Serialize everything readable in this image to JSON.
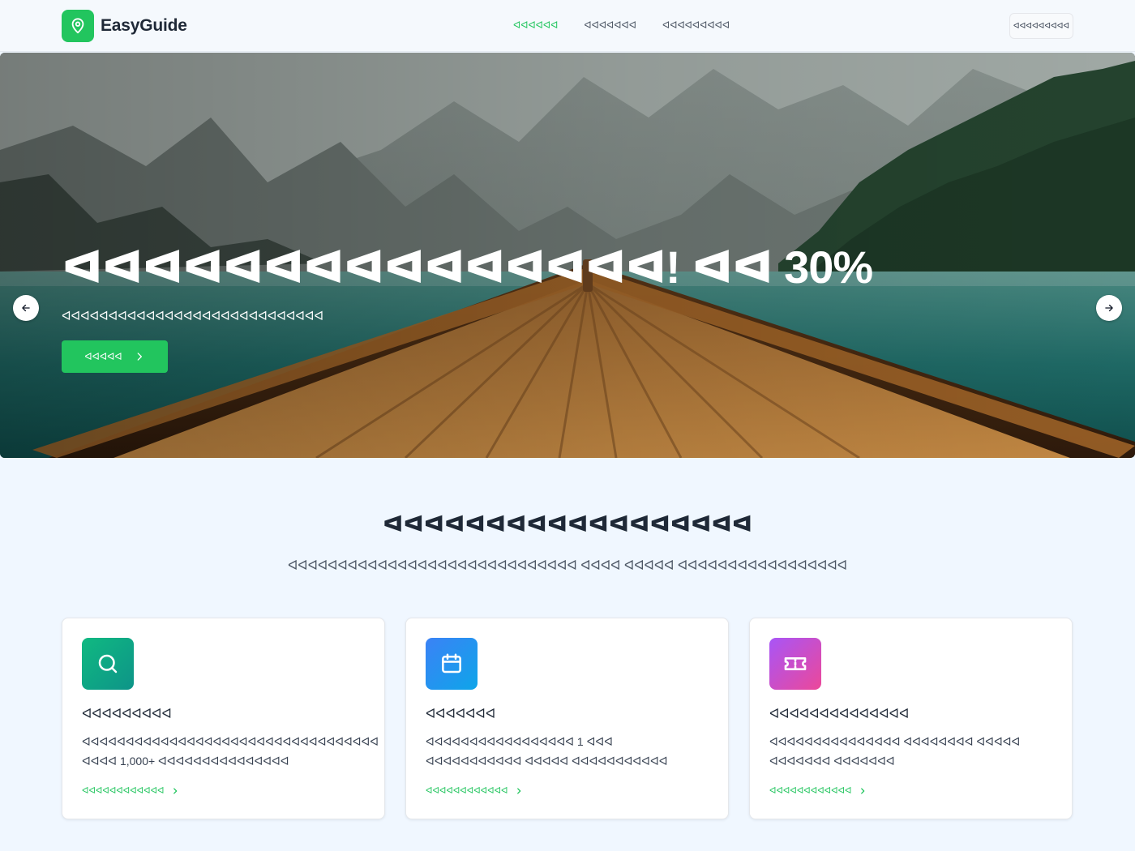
{
  "brand": {
    "name": "EasyGuide",
    "icon": "map-pin-icon",
    "accent": "#22c55e"
  },
  "nav": {
    "items": [
      {
        "label": "ᐊᐊᐊᐊᐊᐊ",
        "active": true
      },
      {
        "label": "ᐊᐊᐊᐊᐊᐊᐊ",
        "active": false
      },
      {
        "label": "ᐊᐊᐊᐊᐊᐊᐊᐊᐊ",
        "active": false
      }
    ],
    "signin": "ᐊᐊᐊᐊᐊᐊᐊᐊᐊ"
  },
  "hero": {
    "title": "ᐊᐊᐊᐊᐊᐊᐊᐊᐊᐊᐊᐊᐊᐊᐊ! ᐊᐊ 30%",
    "subtitle": "ᐊᐊᐊᐊᐊᐊᐊᐊᐊᐊᐊᐊᐊᐊᐊᐊᐊᐊᐊᐊᐊᐊᐊᐊᐊᐊᐊᐊ",
    "cta": "ᐊᐊᐊᐊᐊ",
    "prev_icon": "arrow-left-icon",
    "next_icon": "arrow-right-icon"
  },
  "features": {
    "title": "ᐊᐊᐊᐊᐊᐊᐊᐊᐊᐊᐊᐊᐊᐊᐊᐊᐊᐊ",
    "subtitle": "ᐊᐊᐊᐊᐊᐊᐊᐊᐊᐊᐊᐊᐊᐊᐊᐊᐊᐊᐊᐊᐊᐊᐊᐊᐊᐊᐊᐊᐊ ᐊᐊᐊᐊ ᐊᐊᐊᐊᐊ ᐊᐊᐊᐊᐊᐊᐊᐊᐊᐊᐊᐊᐊᐊᐊᐊᐊ",
    "cards": [
      {
        "icon": "search-icon",
        "title": "ᐊᐊᐊᐊᐊᐊᐊᐊᐊ",
        "description": "ᐊᐊᐊᐊᐊᐊᐊᐊᐊᐊᐊᐊᐊᐊᐊᐊᐊᐊᐊᐊᐊᐊᐊᐊᐊᐊᐊᐊᐊᐊᐊᐊᐊᐊ ᐊᐊᐊᐊ 1,000+ ᐊᐊᐊᐊᐊᐊᐊᐊᐊᐊᐊᐊᐊᐊᐊ",
        "link": "ᐊᐊᐊᐊᐊᐊᐊᐊᐊᐊᐊᐊ"
      },
      {
        "icon": "calendar-icon",
        "title": "ᐊᐊᐊᐊᐊᐊᐊ",
        "description": "ᐊᐊᐊᐊᐊᐊᐊᐊᐊᐊᐊᐊᐊᐊᐊᐊᐊ 1 ᐊᐊᐊ ᐊᐊᐊᐊᐊᐊᐊᐊᐊᐊᐊ ᐊᐊᐊᐊᐊ ᐊᐊᐊᐊᐊᐊᐊᐊᐊᐊᐊ",
        "link": "ᐊᐊᐊᐊᐊᐊᐊᐊᐊᐊᐊᐊ"
      },
      {
        "icon": "ticket-icon",
        "title": "ᐊᐊᐊᐊᐊᐊᐊᐊᐊᐊᐊᐊᐊᐊ",
        "description": "ᐊᐊᐊᐊᐊᐊᐊᐊᐊᐊᐊᐊᐊᐊᐊ ᐊᐊᐊᐊᐊᐊᐊᐊ ᐊᐊᐊᐊᐊ ᐊᐊᐊᐊᐊᐊᐊ ᐊᐊᐊᐊᐊᐊᐊ",
        "link": "ᐊᐊᐊᐊᐊᐊᐊᐊᐊᐊᐊᐊ"
      }
    ]
  }
}
